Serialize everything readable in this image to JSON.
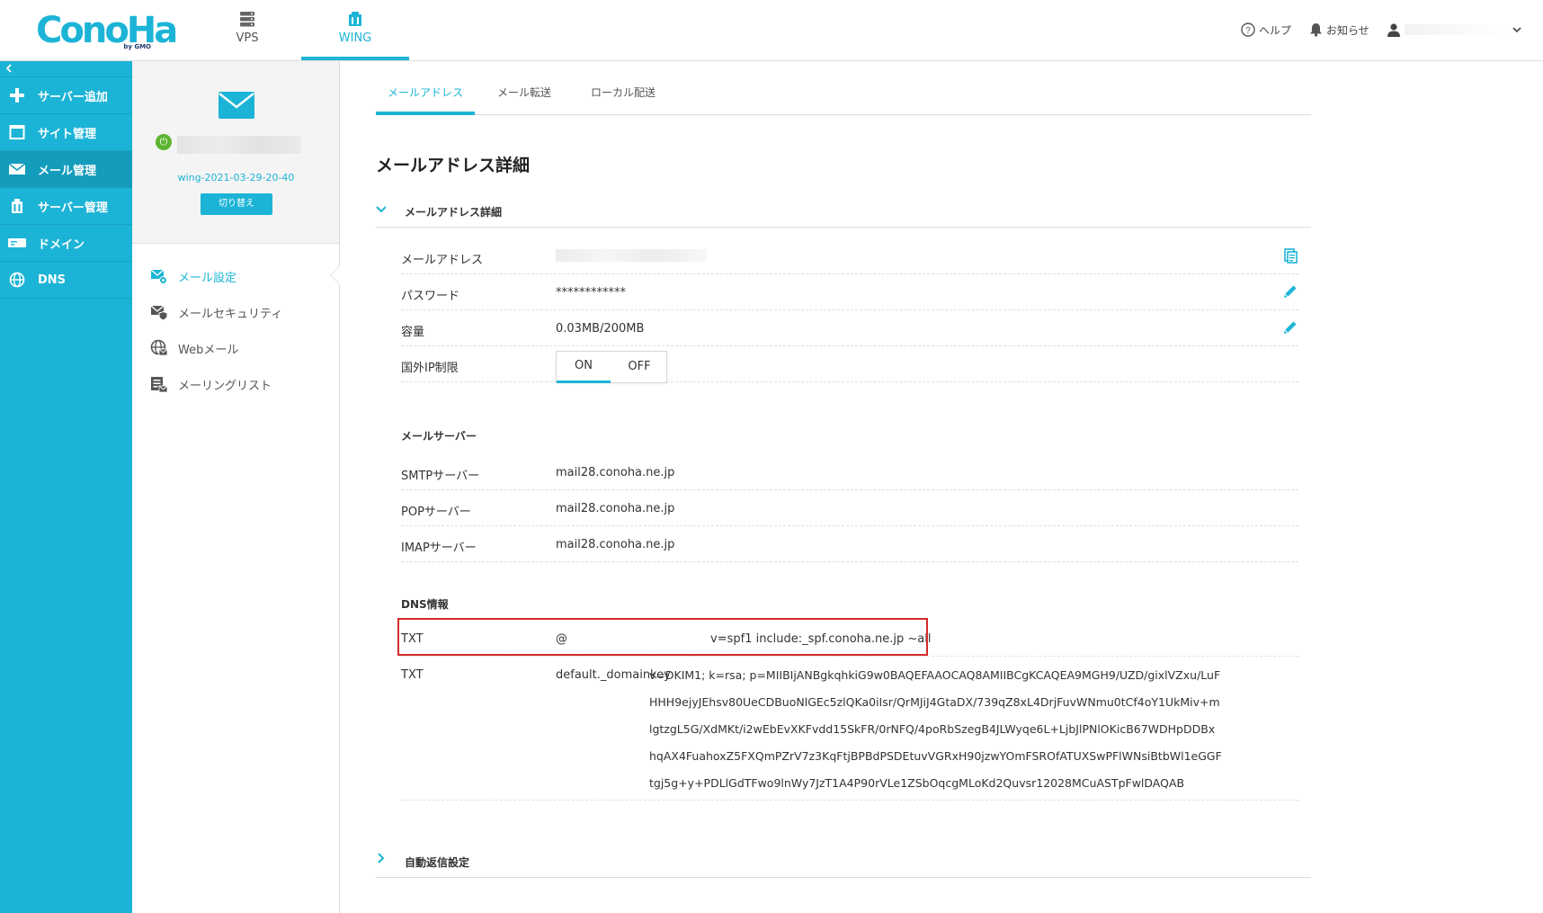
{
  "header": {
    "logo_text": "ConoHa",
    "logo_sub": "by GMO",
    "nav": [
      {
        "label": "VPS",
        "icon": "server-icon"
      },
      {
        "label": "WING",
        "icon": "wing-icon"
      }
    ],
    "help_label": "ヘルプ",
    "news_label": "お知らせ"
  },
  "sidebar": {
    "collapse_icon": "chevron-left-icon",
    "items": [
      {
        "label": "サーバー追加",
        "icon": "plus-icon"
      },
      {
        "label": "サイト管理",
        "icon": "window-icon"
      },
      {
        "label": "メール管理",
        "icon": "mail-icon"
      },
      {
        "label": "サーバー管理",
        "icon": "server-manage-icon"
      },
      {
        "label": "ドメイン",
        "icon": "domain-icon"
      },
      {
        "label": "DNS",
        "icon": "globe-icon"
      }
    ]
  },
  "subpanel": {
    "wing_id": "wing-2021-03-29-20-40",
    "switch_label": "切り替え",
    "menu": [
      {
        "label": "メール設定",
        "icon": "mail-settings-icon"
      },
      {
        "label": "メールセキュリティ",
        "icon": "mail-security-icon"
      },
      {
        "label": "Webメール",
        "icon": "webmail-icon"
      },
      {
        "label": "メーリングリスト",
        "icon": "mailing-list-icon"
      }
    ]
  },
  "main": {
    "tabs": [
      "メールアドレス",
      "メール転送",
      "ローカル配送"
    ],
    "title": "メールアドレス詳細",
    "section1": "メールアドレス詳細",
    "section2": "自動返信設定",
    "rows": {
      "address_label": "メールアドレス",
      "password_label": "パスワード",
      "password_value": "************",
      "capacity_label": "容量",
      "capacity_value": "0.03MB/200MB",
      "ip_label": "国外IP制限",
      "ip_on": "ON",
      "ip_off": "OFF"
    },
    "mail_server": {
      "title": "メールサーバー",
      "smtp_label": "SMTPサーバー",
      "smtp_value": "mail28.conoha.ne.jp",
      "pop_label": "POPサーバー",
      "pop_value": "mail28.conoha.ne.jp",
      "imap_label": "IMAPサーバー",
      "imap_value": "mail28.conoha.ne.jp"
    },
    "dns": {
      "title": "DNS情報",
      "records": [
        {
          "type": "TXT",
          "name": "@",
          "value": "v=spf1 include:_spf.conoha.ne.jp ~all"
        },
        {
          "type": "TXT",
          "name": "default._domainkey",
          "value_lines": [
            "v=DKIM1; k=rsa; p=MIIBIjANBgkqhkiG9w0BAQEFAAOCAQ8AMIIBCgKCAQEA9MGH9/UZD/gixlVZxu/LuF",
            "HHH9ejyJEhsv80UeCDBuoNlGEc5zlQKa0iIsr/QrMJiJ4GtaDX/739qZ8xL4DrjFuvWNmu0tCf4oY1UkMiv+m",
            "lgtzgL5G/XdMKt/i2wEbEvXKFvdd15SkFR/0rNFQ/4poRbSzegB4JLWyqe6L+LjbJlPNlOKicB67WDHpDDBx",
            "hqAX4FuahoxZ5FXQmPZrV7z3KqFtjBPBdPSDEtuvVGRxH90jzwYOmFSROfATUXSwPFlWNsiBtbWl1eGGF",
            "tgj5g+y+PDLlGdTFwo9lnWy7JzT1A4P90rVLe1ZSbOqcgMLoKd2Quvsr12028MCuASTpFwlDAQAB"
          ]
        }
      ]
    }
  }
}
